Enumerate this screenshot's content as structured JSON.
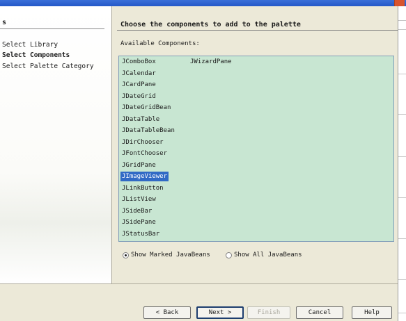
{
  "steps": {
    "title": "s",
    "items": [
      "Select Library",
      "Select Components",
      "Select Palette Category"
    ],
    "current_index": 1
  },
  "content": {
    "heading": "Choose the components to add to the palette",
    "available_label": "Available Components:"
  },
  "components": {
    "column1": [
      "JComboBox",
      "JCalendar",
      "JCardPane",
      "JDateGrid",
      "JDateGridBean",
      "JDataTable",
      "JDataTableBean",
      "JDirChooser",
      "JFontChooser",
      "JGridPane",
      "JImageViewer",
      "JLinkButton",
      "JListView",
      "JSideBar",
      "JSidePane",
      "JStatusBar"
    ],
    "column2": [
      "JWizardPane"
    ],
    "selected": "JImageViewer"
  },
  "options": {
    "marked": "Show Marked JavaBeans",
    "all": "Show All JavaBeans",
    "selected": "marked"
  },
  "buttons": {
    "back": "< Back",
    "next": "Next >",
    "finish": "Finish",
    "cancel": "Cancel",
    "help": "Help"
  }
}
